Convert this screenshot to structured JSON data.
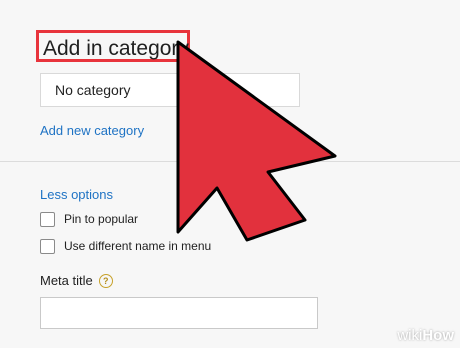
{
  "category_section": {
    "title": "Add in category",
    "selected_category": "No category",
    "add_new_link": "Add new category"
  },
  "options": {
    "less_options_link": "Less options",
    "checkboxes": [
      {
        "label": "Pin to popular",
        "checked": false
      },
      {
        "label": "Use different name in menu",
        "checked": false
      }
    ]
  },
  "meta": {
    "title_label": "Meta title",
    "help_icon": "question-mark-icon",
    "help_glyph": "?",
    "title_value": ""
  },
  "overlay": {
    "cursor_icon": "large-arrow-cursor-icon",
    "cursor_color": "#e2313d",
    "highlight_color": "#e8343c"
  },
  "watermark": {
    "prefix": "wiki",
    "suffix": "How"
  }
}
